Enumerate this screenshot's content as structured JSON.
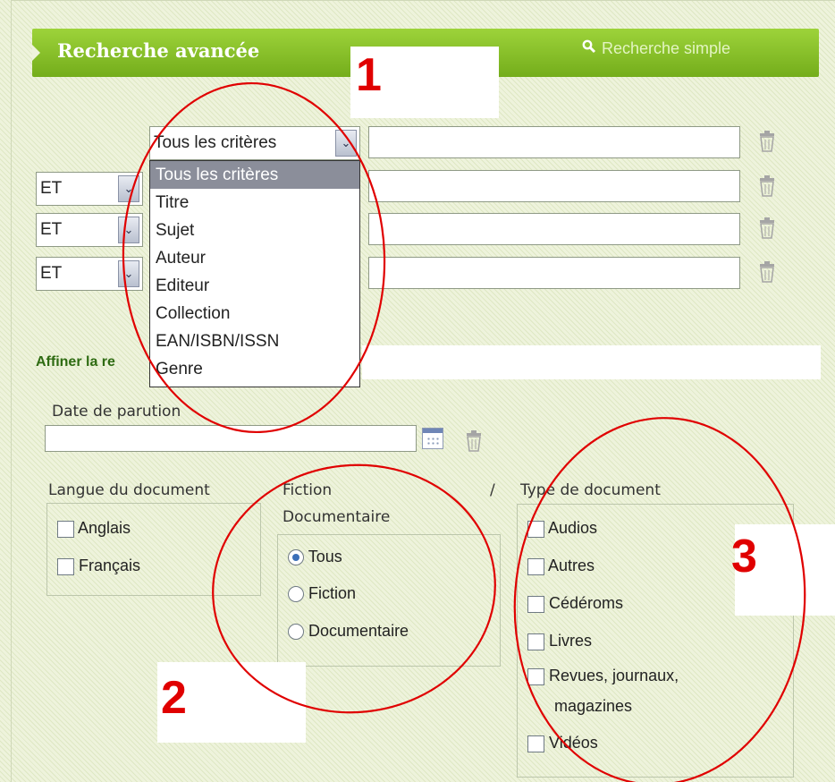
{
  "header": {
    "title": "Recherche avancée",
    "simple_search_label": "Recherche simple",
    "search_icon": "search-icon"
  },
  "criteria": {
    "first_select_value": "Tous les critères",
    "operators": [
      "ET",
      "ET",
      "ET"
    ],
    "options": [
      "Tous les critères",
      "Titre",
      "Sujet",
      "Auteur",
      "Editeur",
      "Collection",
      "EAN/ISBN/ISSN",
      "Genre"
    ],
    "selected_option": "Tous les critères",
    "delete_icon": "trash-icon"
  },
  "refine": {
    "title": "Affiner la re",
    "date_label": "Date de parution",
    "calendar_icon": "calendar-icon"
  },
  "language": {
    "label": "Langue du document",
    "options": [
      "Anglais",
      "Français"
    ]
  },
  "fiction": {
    "label_line1": "Fiction",
    "slash": "/",
    "label_line2": "Documentaire",
    "options": [
      "Tous",
      "Fiction",
      "Documentaire"
    ],
    "selected": "Tous"
  },
  "doctype": {
    "label": "Type de document",
    "options": [
      "Audios",
      "Autres",
      "Cédéroms",
      "Livres",
      "Revues, journaux,",
      "magazines",
      "Vidéos"
    ]
  },
  "annotations": {
    "one": "1",
    "two": "2",
    "three": "3",
    "color": "#e00000"
  },
  "colors": {
    "header_green": "#86c12a",
    "section_title": "#2e6b12",
    "selected_option_bg": "#8b8e9a"
  }
}
